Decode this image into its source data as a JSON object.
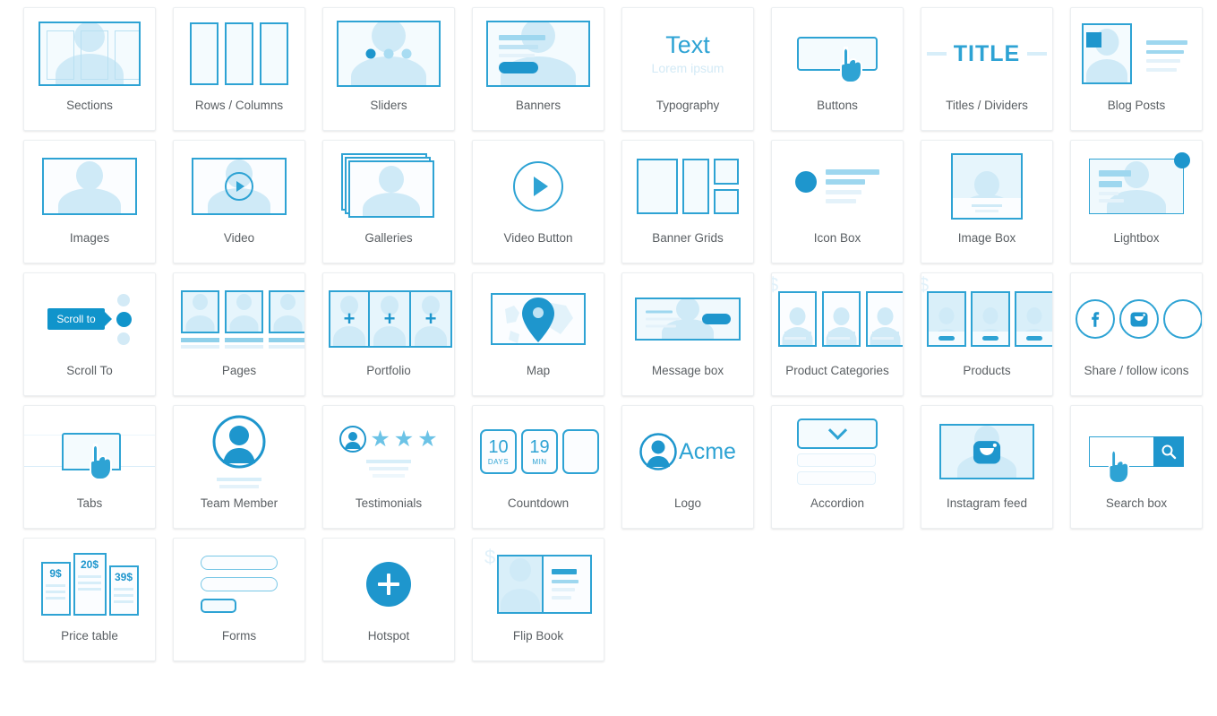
{
  "page": {
    "title": "Page builder elements grid",
    "accent": "#2ea3d4",
    "accent_dark": "#1e96cd",
    "accent_fill": "#cfeaf7",
    "label_color": "#5a5f63",
    "card_bg": "#ffffff",
    "background": "#ffffff"
  },
  "rows": [
    {
      "items": [
        {
          "label": "Sections",
          "icon": "sections-icon"
        },
        {
          "label": "Rows / Columns",
          "icon": "rows-columns-icon"
        },
        {
          "label": "Sliders",
          "icon": "sliders-icon"
        },
        {
          "label": "Banners",
          "icon": "banners-icon"
        },
        {
          "label": "Typography",
          "icon": "typography-icon"
        },
        {
          "label": "Buttons",
          "icon": "buttons-icon"
        },
        {
          "label": "Titles / Dividers",
          "icon": "titles-dividers-icon"
        },
        {
          "label": "Blog Posts",
          "icon": "blog-posts-icon"
        }
      ]
    },
    {
      "items": [
        {
          "label": "Images",
          "icon": "images-icon"
        },
        {
          "label": "Video",
          "icon": "video-icon"
        },
        {
          "label": "Galleries",
          "icon": "galleries-icon"
        },
        {
          "label": "Video Button",
          "icon": "video-button-icon"
        },
        {
          "label": "Banner Grids",
          "icon": "banner-grids-icon"
        },
        {
          "label": "Icon Box",
          "icon": "icon-box-icon"
        },
        {
          "label": "Image Box",
          "icon": "image-box-icon"
        },
        {
          "label": "Lightbox",
          "icon": "lightbox-icon"
        }
      ]
    },
    {
      "items": [
        {
          "label": "Scroll To",
          "icon": "scroll-to-icon"
        },
        {
          "label": "Pages",
          "icon": "pages-icon"
        },
        {
          "label": "Portfolio",
          "icon": "portfolio-icon"
        },
        {
          "label": "Map",
          "icon": "map-icon"
        },
        {
          "label": "Message box",
          "icon": "message-box-icon"
        },
        {
          "label": "Product Categories",
          "icon": "product-categories-icon"
        },
        {
          "label": "Products",
          "icon": "products-icon"
        },
        {
          "label": "Share / follow icons",
          "icon": "share-follow-icons-icon"
        }
      ]
    },
    {
      "items": [
        {
          "label": "Tabs",
          "icon": "tabs-icon"
        },
        {
          "label": "Team Member",
          "icon": "team-member-icon"
        },
        {
          "label": "Testimonials",
          "icon": "testimonials-icon"
        },
        {
          "label": "Countdown",
          "icon": "countdown-icon"
        },
        {
          "label": "Logo",
          "icon": "logo-icon"
        },
        {
          "label": "Accordion",
          "icon": "accordion-icon"
        },
        {
          "label": "Instagram feed",
          "icon": "instagram-feed-icon"
        },
        {
          "label": "Search box",
          "icon": "search-box-icon"
        }
      ]
    },
    {
      "items": [
        {
          "label": "Price table",
          "icon": "price-table-icon"
        },
        {
          "label": "Forms",
          "icon": "forms-icon"
        },
        {
          "label": "Hotspot",
          "icon": "hotspot-icon"
        },
        {
          "label": "Flip Book",
          "icon": "flip-book-icon"
        }
      ]
    }
  ],
  "icon_text": {
    "typography_main": "Text",
    "typography_sub": "Lorem ipsum",
    "title_word": "TITLE",
    "scroll_to_pill": "Scroll to",
    "countdown": [
      {
        "num": "10",
        "unit": "DAYS"
      },
      {
        "num": "19",
        "unit": "MIN"
      }
    ],
    "logo_text": "Acme",
    "prices": [
      "9$",
      "20$",
      "39$"
    ],
    "currency_symbol": "$",
    "portfolio_plus": "+",
    "stars": "★"
  }
}
